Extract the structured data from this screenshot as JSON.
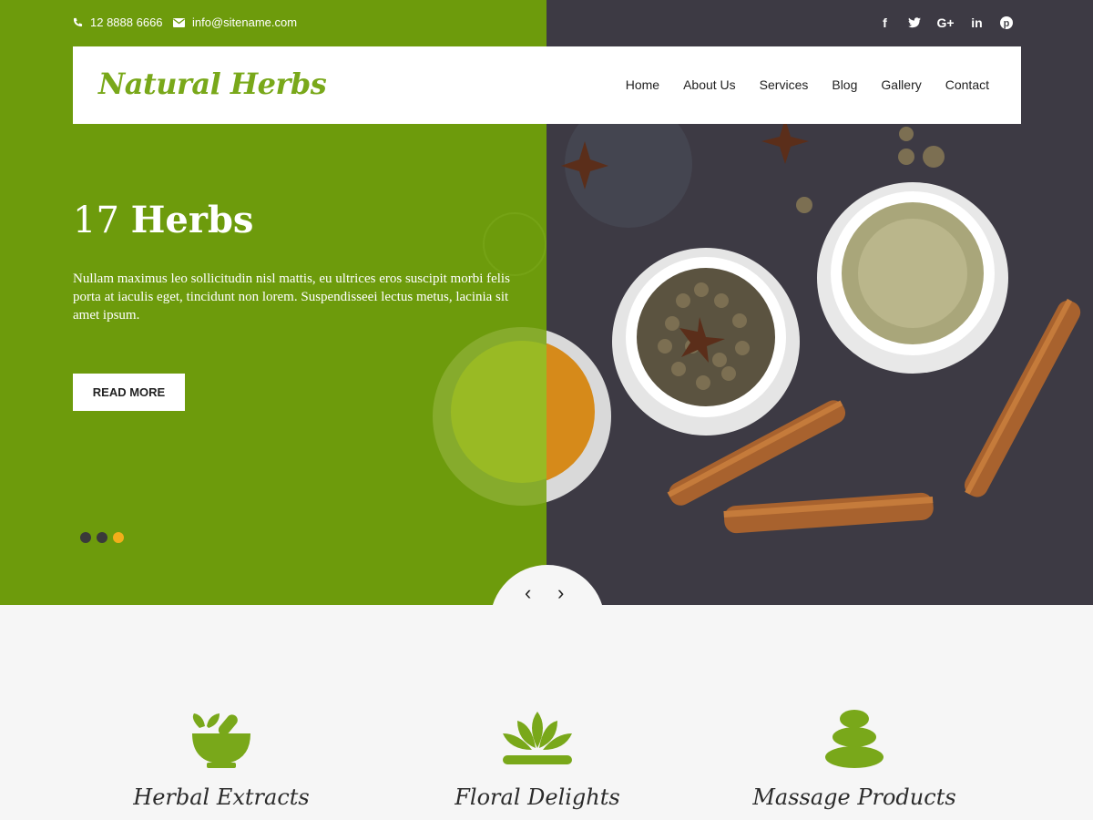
{
  "topbar": {
    "phone": "12 8888 6666",
    "email": "info@sitename.com",
    "social_icons": [
      "facebook-icon",
      "twitter-icon",
      "google-plus-icon",
      "linkedin-icon",
      "pinterest-icon"
    ]
  },
  "brand": {
    "logo": "Natural Herbs"
  },
  "nav": {
    "items": [
      {
        "label": "Home"
      },
      {
        "label": "About Us"
      },
      {
        "label": "Services"
      },
      {
        "label": "Blog"
      },
      {
        "label": "Gallery"
      },
      {
        "label": "Contact"
      }
    ]
  },
  "hero": {
    "title_num": "17",
    "title_word": "Herbs",
    "description": "Nullam maximus leo sollicitudin nisl mattis, eu ultrices eros suscipit morbi felis porta at iaculis eget, tincidunt non lorem. Suspendisseei lectus metus, lacinia sit amet ipsum.",
    "button": "READ MORE",
    "slides_total": 3,
    "active_slide": 3,
    "prev_arrow": "‹",
    "next_arrow": "›"
  },
  "features": [
    {
      "title": "Herbal Extracts",
      "icon": "mortar-pestle-icon"
    },
    {
      "title": "Floral Delights",
      "icon": "lotus-icon"
    },
    {
      "title": "Massage Products",
      "icon": "stacked-stones-icon"
    }
  ],
  "colors": {
    "accent": "#79a81a",
    "hero_green": "#6d9b0c",
    "dark_bg": "#3e3b45",
    "dot_active": "#f2ae1a",
    "page_bg": "#f6f6f6"
  }
}
